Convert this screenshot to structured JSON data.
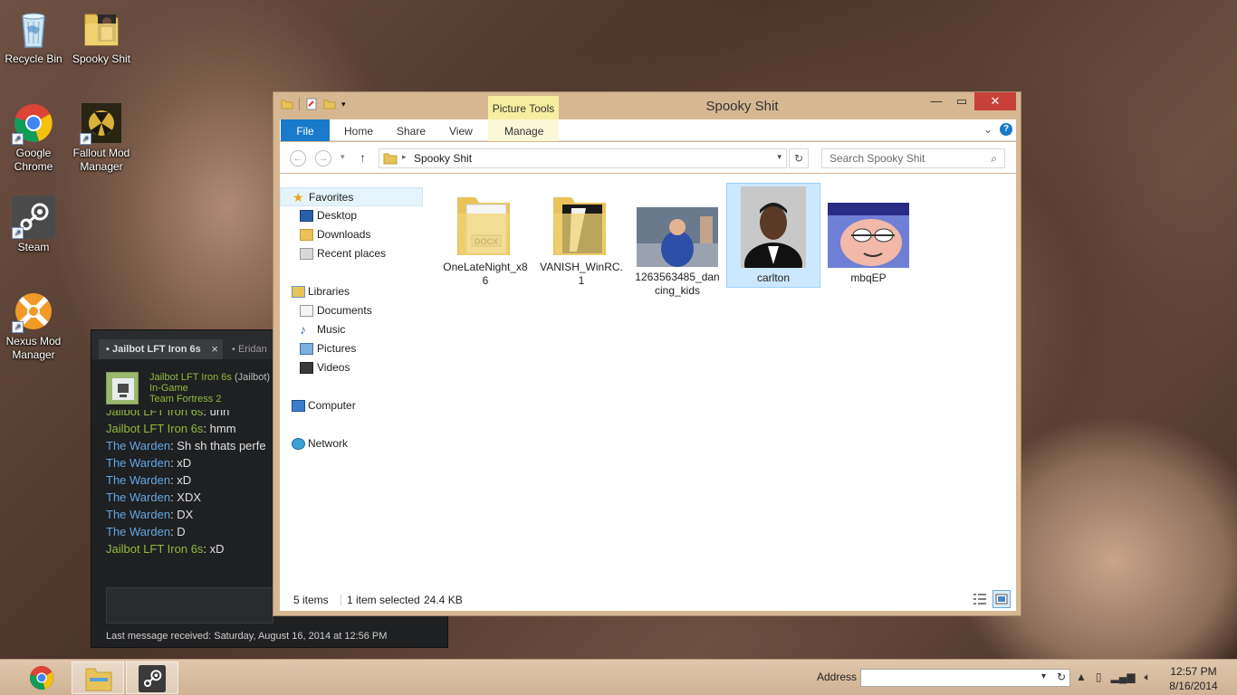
{
  "desktop": {
    "icons": [
      {
        "label": "Recycle Bin"
      },
      {
        "label": "Spooky Shit"
      },
      {
        "label": "Google Chrome"
      },
      {
        "label": "Fallout Mod Manager"
      },
      {
        "label": "Steam"
      },
      {
        "label": "Nexus Mod Manager"
      }
    ]
  },
  "explorer": {
    "title": "Spooky Shit",
    "context_tab_group": "Picture Tools",
    "ribbon_tabs": [
      "File",
      "Home",
      "Share",
      "View",
      "Manage"
    ],
    "address_path": "Spooky Shit",
    "search_placeholder": "Search Spooky Shit",
    "nav": {
      "favorites": "Favorites",
      "desktop": "Desktop",
      "downloads": "Downloads",
      "recent": "Recent places",
      "libraries": "Libraries",
      "documents": "Documents",
      "music": "Music",
      "pictures": "Pictures",
      "videos": "Videos",
      "computer": "Computer",
      "network": "Network"
    },
    "files": [
      {
        "name": "OneLateNight_x86",
        "kind": "folder-docx"
      },
      {
        "name": "VANISH_WinRC.1",
        "kind": "folder"
      },
      {
        "name": "1263563485_dancing_kids",
        "kind": "image"
      },
      {
        "name": "carlton",
        "kind": "image",
        "selected": true
      },
      {
        "name": "mbqEP",
        "kind": "image"
      }
    ],
    "status": {
      "items": "5 items",
      "selected": "1 item selected",
      "size": "24.4 KB"
    }
  },
  "chat": {
    "tabs": [
      "Jailbot LFT Iron 6s",
      "Eridan"
    ],
    "friend_name": "Jailbot LFT Iron 6s",
    "friend_alias": "(Jailbot)",
    "friend_status": "In-Game",
    "friend_game": "Team Fortress 2",
    "messages": [
      {
        "sender": "Jailbot LFT Iron 6s",
        "text": "uhh",
        "who": "friend"
      },
      {
        "sender": "Jailbot LFT Iron 6s",
        "text": "hmm",
        "who": "friend"
      },
      {
        "sender": "The Warden",
        "text": "Sh sh thats perfe",
        "who": "me"
      },
      {
        "sender": "The Warden",
        "text": "xD",
        "who": "me"
      },
      {
        "sender": "The Warden",
        "text": "xD",
        "who": "me"
      },
      {
        "sender": "The Warden",
        "text": "XDX",
        "who": "me"
      },
      {
        "sender": "The Warden",
        "text": "DX",
        "who": "me"
      },
      {
        "sender": "The Warden",
        "text": "D",
        "who": "me"
      },
      {
        "sender": "Jailbot LFT Iron 6s",
        "text": "xD",
        "who": "friend"
      }
    ],
    "footer": "Last message received: Saturday, August 16, 2014 at 12:56 PM"
  },
  "taskbar": {
    "address_label": "Address",
    "time": "12:57 PM",
    "date": "8/16/2014"
  }
}
